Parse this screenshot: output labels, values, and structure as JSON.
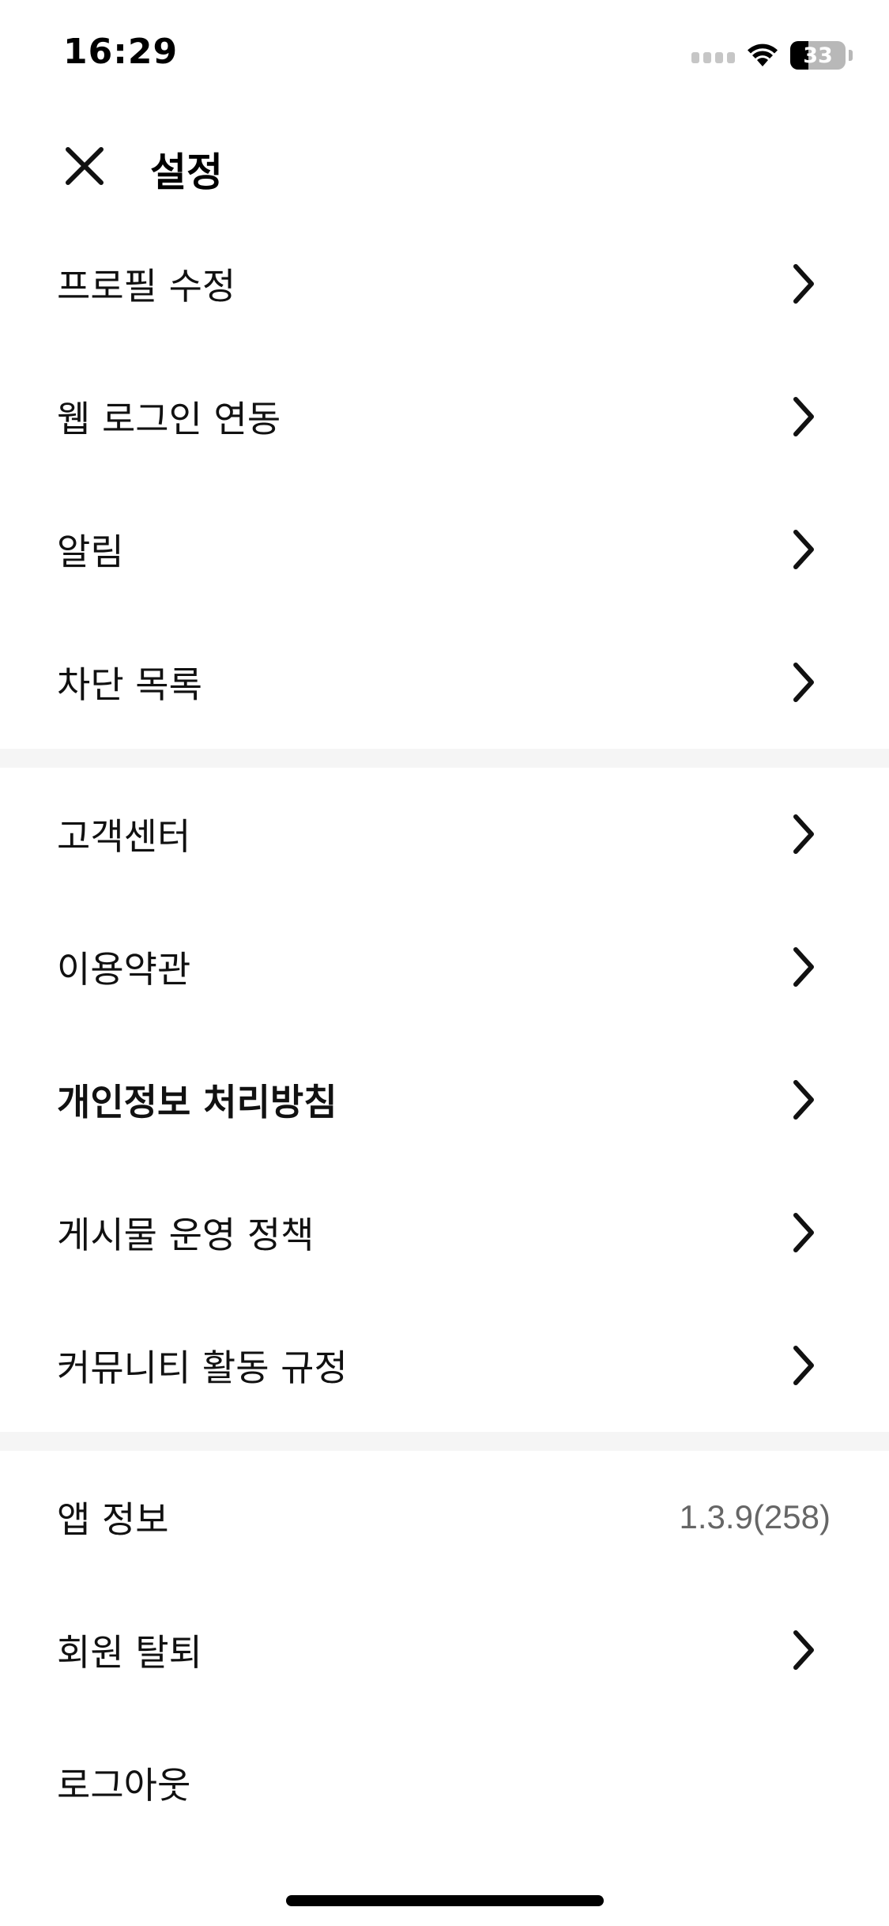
{
  "status_bar": {
    "time": "16:29",
    "battery_level": "33",
    "battery_fraction": 0.33
  },
  "header": {
    "title": "설정",
    "close_icon": "close-icon"
  },
  "sections": [
    {
      "items": [
        {
          "label": "프로필 수정",
          "chevron": true
        },
        {
          "label": "웹 로그인 연동",
          "chevron": true
        },
        {
          "label": "알림",
          "chevron": true
        },
        {
          "label": "차단 목록",
          "chevron": true
        }
      ]
    },
    {
      "items": [
        {
          "label": "고객센터",
          "chevron": true
        },
        {
          "label": "이용약관",
          "chevron": true
        },
        {
          "label": "개인정보 처리방침",
          "chevron": true,
          "bold": true
        },
        {
          "label": "게시물 운영 정책",
          "chevron": true
        },
        {
          "label": "커뮤니티 활동 규정",
          "chevron": true
        }
      ]
    },
    {
      "items": [
        {
          "label": "앱 정보",
          "value": "1.3.9(258)"
        },
        {
          "label": "회원 탈퇴",
          "chevron": true
        },
        {
          "label": "로그아웃"
        }
      ]
    }
  ],
  "colors": {
    "text": "#111111",
    "secondary_text": "#666666",
    "divider": "#f5f5f5",
    "background": "#ffffff"
  }
}
